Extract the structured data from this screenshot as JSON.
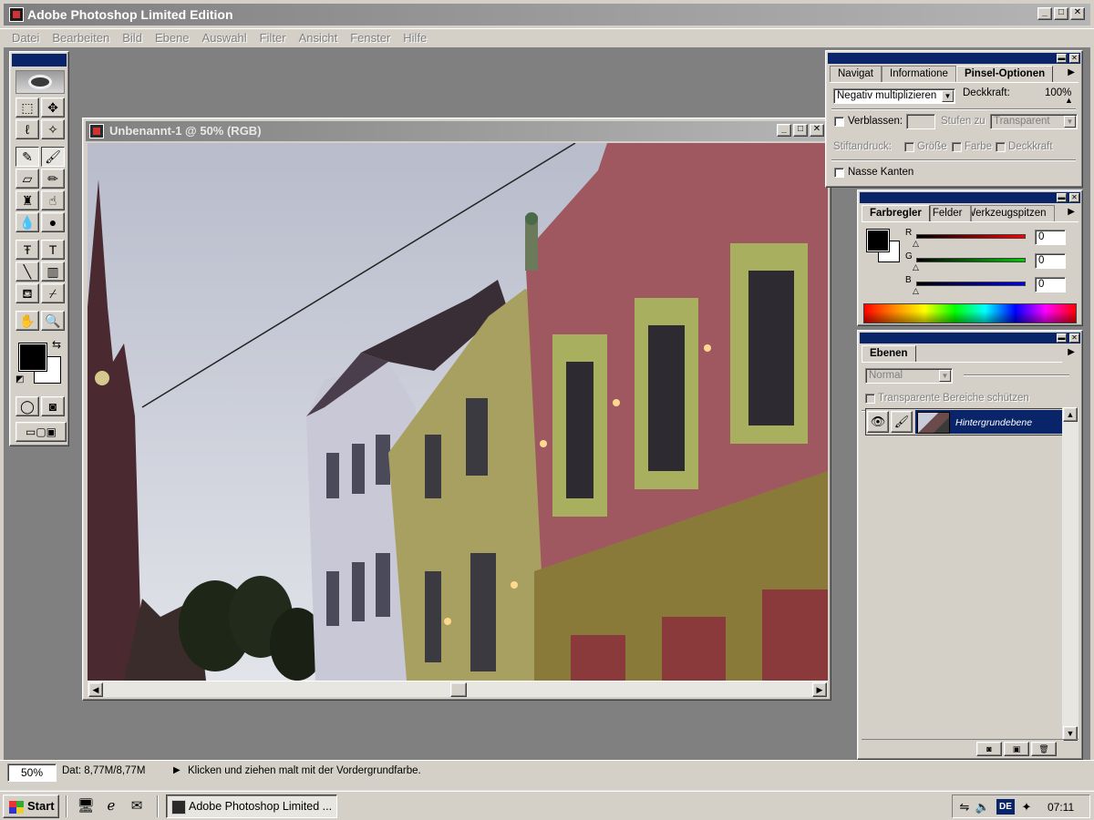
{
  "app": {
    "title": "Adobe Photoshop Limited Edition",
    "window_buttons": [
      "_",
      "□",
      "✕"
    ]
  },
  "menu": [
    "Datei",
    "Bearbeiten",
    "Bild",
    "Ebene",
    "Auswahl",
    "Filter",
    "Ansicht",
    "Fenster",
    "Hilfe"
  ],
  "toolbox": {
    "tools": [
      {
        "name": "marquee-tool-icon",
        "glyph": "⬚"
      },
      {
        "name": "move-tool-icon",
        "glyph": "✥"
      },
      {
        "name": "lasso-tool-icon",
        "glyph": "ℓ"
      },
      {
        "name": "magic-wand-tool-icon",
        "glyph": "✧"
      },
      {
        "name": "airbrush-tool-icon",
        "glyph": "✎",
        "pressed": true
      },
      {
        "name": "paintbrush-tool-icon",
        "glyph": "🖌",
        "pressed": true
      },
      {
        "name": "eraser-tool-icon",
        "glyph": "▱"
      },
      {
        "name": "pencil-tool-icon",
        "glyph": "✏"
      },
      {
        "name": "rubber-stamp-tool-icon",
        "glyph": "♜"
      },
      {
        "name": "smudge-tool-icon",
        "glyph": "☝"
      },
      {
        "name": "blur-tool-icon",
        "glyph": "💧"
      },
      {
        "name": "burn-tool-icon",
        "glyph": "●"
      },
      {
        "name": "type-mask-tool-icon",
        "glyph": "Ŧ"
      },
      {
        "name": "type-tool-icon",
        "glyph": "T"
      },
      {
        "name": "line-tool-icon",
        "glyph": "╲"
      },
      {
        "name": "gradient-tool-icon",
        "glyph": "▥"
      },
      {
        "name": "paint-bucket-tool-icon",
        "glyph": "⛾"
      },
      {
        "name": "eyedropper-tool-icon",
        "glyph": "⌿"
      },
      {
        "name": "hand-tool-icon",
        "glyph": "✋"
      },
      {
        "name": "zoom-tool-icon",
        "glyph": "🔍"
      },
      {
        "name": "standard-mode-icon",
        "glyph": "◯"
      },
      {
        "name": "quick-mask-mode-icon",
        "glyph": "◙"
      }
    ],
    "foreground_color": "#000000",
    "background_color": "#ffffff"
  },
  "document": {
    "title": "Unbenannt-1 @ 50%  (RGB)"
  },
  "brush_panel": {
    "tabs": [
      "Navigat",
      "Informatione",
      "Pinsel-Optionen"
    ],
    "mode": "Negativ multiplizieren",
    "opacity_label": "Deckkraft:",
    "opacity_value": "100%",
    "fade_label": "Verblassen:",
    "steps_label": "Stufen zu",
    "steps_target": "Transparent",
    "stylus_label": "Stiftandruck:",
    "stylus_size": "Größe",
    "stylus_color": "Farbe",
    "stylus_opacity": "Deckkraft",
    "wet_edges": "Nasse Kanten"
  },
  "color_panel": {
    "tabs": [
      "Farbregler",
      "Felder",
      "Werkzeugspitzen"
    ],
    "channels": [
      {
        "label": "R",
        "value": "0",
        "color": "#cc0000"
      },
      {
        "label": "G",
        "value": "0",
        "color": "#00aa00"
      },
      {
        "label": "B",
        "value": "0",
        "color": "#0000cc"
      }
    ]
  },
  "layers_panel": {
    "tab": "Ebenen",
    "blend_mode": "Normal",
    "preserve_transparency": "Transparente Bereiche schützen",
    "layer_name": "Hintergrundebene"
  },
  "status": {
    "zoom": "50%",
    "doc_size": "Dat: 8,77M/8,77M",
    "message": "Klicken und ziehen malt mit der Vordergrundfarbe."
  },
  "taskbar": {
    "start": "Start",
    "task": "Adobe Photoshop Limited ...",
    "language": "DE",
    "clock": "07:11"
  },
  "colors": {
    "selection_blue": "#0a246a",
    "workspace_gray": "#808080",
    "face_gray": "#d4d0c8"
  }
}
